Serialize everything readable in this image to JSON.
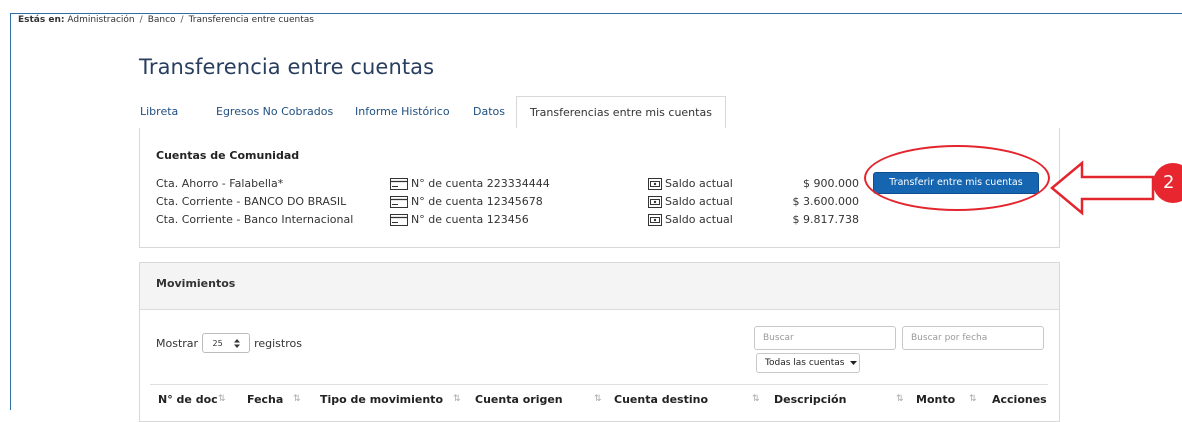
{
  "breadcrumb": {
    "lead": "Estás en:",
    "items": [
      "Administración",
      "Banco",
      "Transferencia entre cuentas"
    ]
  },
  "page_title": "Transferencia entre cuentas",
  "tabs": [
    {
      "label": "Libreta",
      "active": false
    },
    {
      "label": "Egresos No Cobrados",
      "active": false
    },
    {
      "label": "Informe Histórico",
      "active": false
    },
    {
      "label": "Datos",
      "active": false
    },
    {
      "label": "Transferencias entre mis cuentas",
      "active": true
    }
  ],
  "accounts_card": {
    "title": "Cuentas de Comunidad",
    "transfer_button": "Transferir entre mis cuentas",
    "accounts": [
      {
        "name": "Cta. Ahorro - Falabella*",
        "number": "N° de cuenta 223334444",
        "balance_label": "Saldo actual",
        "balance": "$ 900.000"
      },
      {
        "name": "Cta. Corriente - BANCO DO BRASIL",
        "number": "N° de cuenta 12345678",
        "balance_label": "Saldo actual",
        "balance": "$ 3.600.000"
      },
      {
        "name": "Cta. Corriente - Banco Internacional",
        "number": "N° de cuenta 123456",
        "balance_label": "Saldo actual",
        "balance": "$ 9.817.738"
      }
    ]
  },
  "movements": {
    "title": "Movimientos",
    "show_label": "Mostrar",
    "page_size": "25",
    "records_label": "registros",
    "search_placeholder": "Buscar",
    "date_search_placeholder": "Buscar por fecha",
    "accounts_filter": "Todas las cuentas",
    "columns": [
      "N° de doc",
      "Fecha",
      "Tipo de movimiento",
      "Cuenta origen",
      "Cuenta destino",
      "Descripción",
      "Monto",
      "Acciones"
    ]
  },
  "annotation": {
    "step_number": "2",
    "highlight_color": "#e3262e"
  },
  "colors": {
    "accent": "#1565b0",
    "title": "#283e5e",
    "link": "#1f4f80"
  }
}
